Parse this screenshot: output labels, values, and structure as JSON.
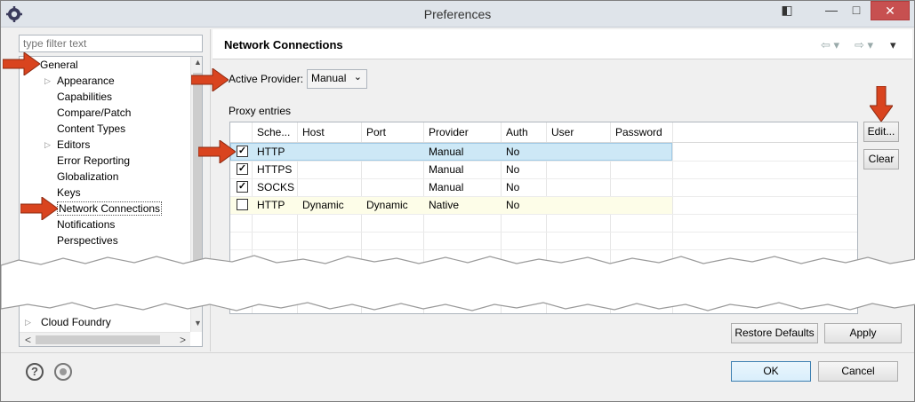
{
  "window": {
    "title": "Preferences"
  },
  "window_controls": {
    "snap": "◧",
    "minimize": "—",
    "maximize": "□",
    "close": "✕"
  },
  "filter": {
    "placeholder": "type filter text"
  },
  "tree": {
    "items": [
      {
        "label": "General",
        "level": 0,
        "twisty": ""
      },
      {
        "label": "Appearance",
        "level": 1,
        "twisty": "▷"
      },
      {
        "label": "Capabilities",
        "level": 1,
        "twisty": ""
      },
      {
        "label": "Compare/Patch",
        "level": 1,
        "twisty": ""
      },
      {
        "label": "Content Types",
        "level": 1,
        "twisty": ""
      },
      {
        "label": "Editors",
        "level": 1,
        "twisty": "▷"
      },
      {
        "label": "Error Reporting",
        "level": 1,
        "twisty": ""
      },
      {
        "label": "Globalization",
        "level": 1,
        "twisty": ""
      },
      {
        "label": "Keys",
        "level": 1,
        "twisty": ""
      },
      {
        "label": "Network Connections",
        "level": 1,
        "twisty": "",
        "selected": true
      },
      {
        "label": "Notifications",
        "level": 1,
        "twisty": ""
      },
      {
        "label": "Perspectives",
        "level": 1,
        "twisty": ""
      }
    ],
    "bottom_items": [
      {
        "label": "Cloud Foundry",
        "twisty": "▷"
      }
    ],
    "scroll_up": "▲",
    "scroll_down": "▼",
    "scroll_left": "<",
    "scroll_right": ">"
  },
  "page": {
    "title": "Network Connections",
    "nav_back": "⇦ ▾",
    "nav_forward": "⇨ ▾",
    "nav_menu": "▾"
  },
  "provider": {
    "label": "Active Provider:",
    "value": "Manual",
    "chevron": "⌄"
  },
  "proxy": {
    "label": "Proxy entries",
    "columns": [
      "Sche...",
      "Host",
      "Port",
      "Provider",
      "Auth",
      "User",
      "Password"
    ],
    "rows": [
      {
        "checked": true,
        "scheme": "HTTP",
        "host": "",
        "port": "",
        "provider": "Manual",
        "auth": "No",
        "user": "",
        "password": ""
      },
      {
        "checked": true,
        "scheme": "HTTPS",
        "host": "",
        "port": "",
        "provider": "Manual",
        "auth": "No",
        "user": "",
        "password": ""
      },
      {
        "checked": true,
        "scheme": "SOCKS",
        "host": "",
        "port": "",
        "provider": "Manual",
        "auth": "No",
        "user": "",
        "password": ""
      },
      {
        "checked": false,
        "scheme": "HTTP",
        "host": "Dynamic",
        "port": "Dynamic",
        "provider": "Native",
        "auth": "No",
        "user": "",
        "password": ""
      }
    ],
    "check_mark": "✓"
  },
  "buttons": {
    "edit": "Edit...",
    "clear": "Clear",
    "restore_defaults": "Restore Defaults",
    "apply": "Apply",
    "ok": "OK",
    "cancel": "Cancel"
  },
  "footer": {
    "help_glyph": "?"
  },
  "colors": {
    "arrow": "#d9441f",
    "selection": "#cde8f6",
    "close_button": "#c75050"
  }
}
